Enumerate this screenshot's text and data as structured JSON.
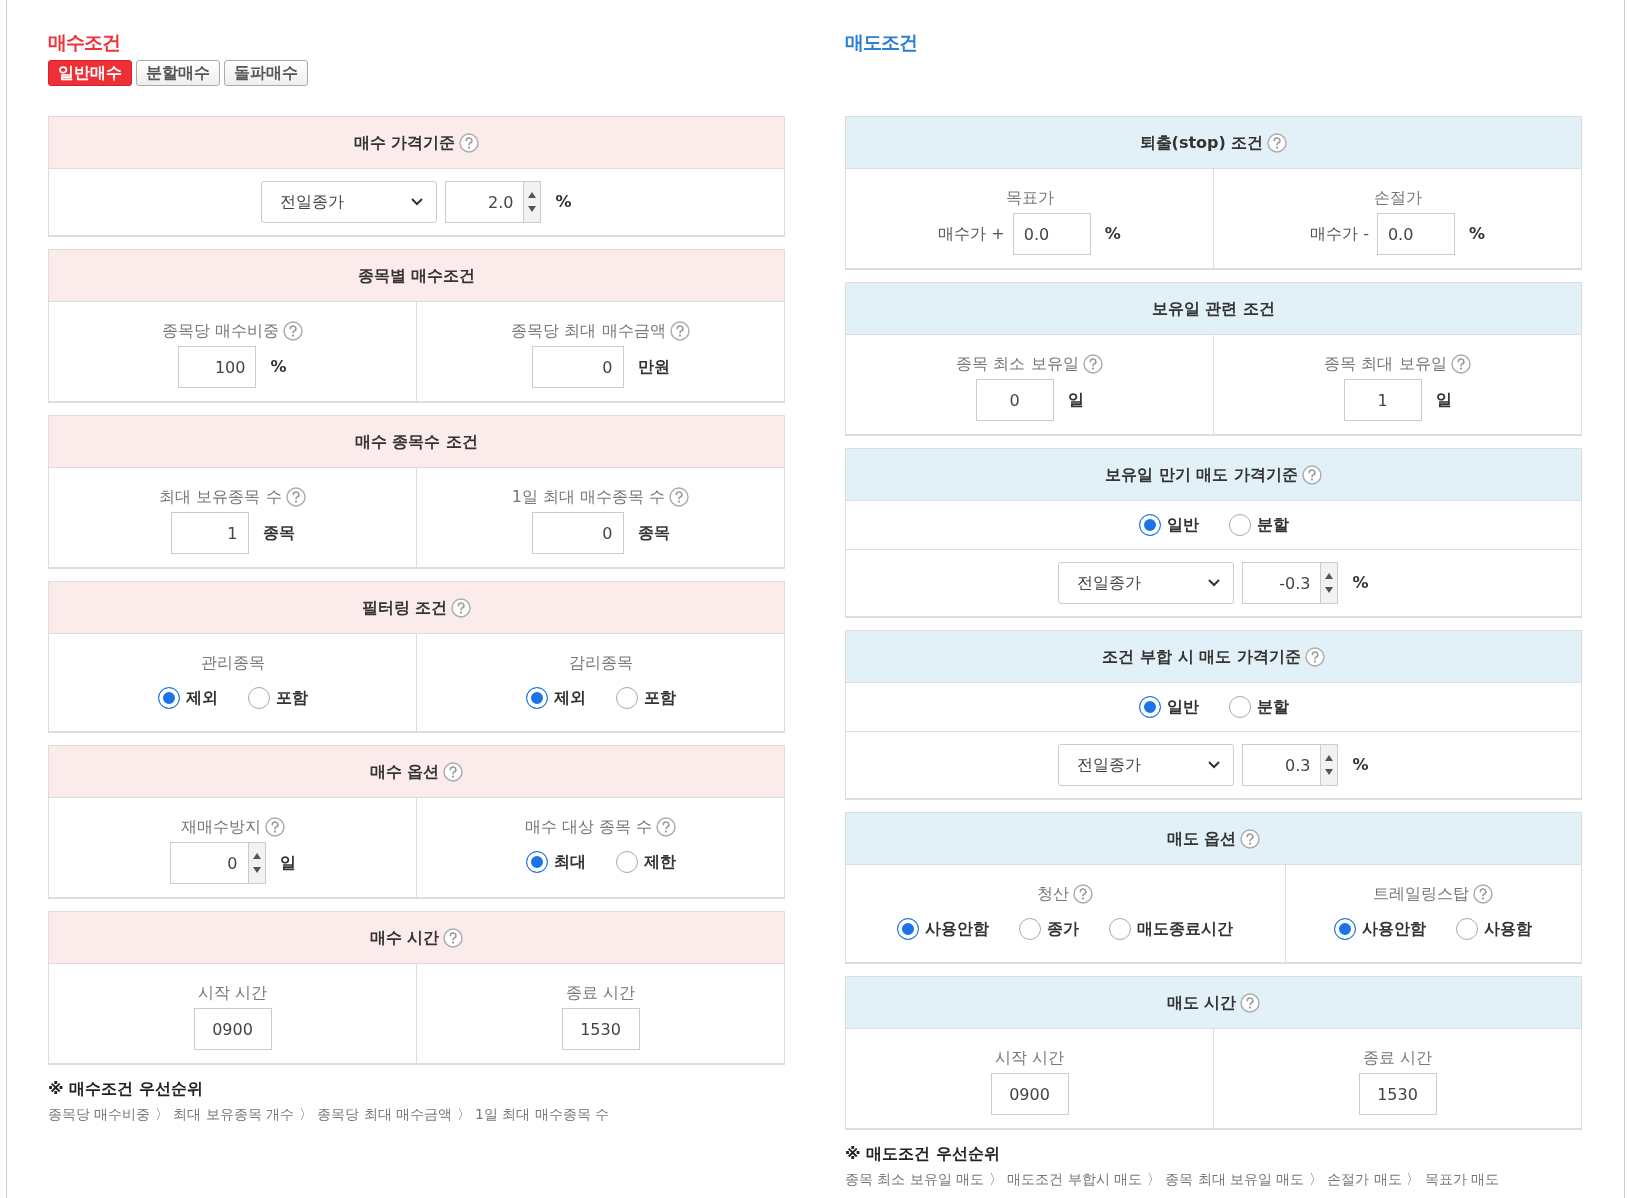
{
  "panels": [
    {
      "kind": "buy",
      "title": "매수조건",
      "tabs": [
        {
          "label": "일반매수",
          "selected": true
        },
        {
          "label": "분할매수",
          "selected": false
        },
        {
          "label": "돌파매수",
          "selected": false
        }
      ],
      "sections": [
        {
          "title": "매수 가격기준",
          "help": true,
          "rows": [
            {
              "cells": [
                {
                  "controls": [
                    {
                      "kind": "select",
                      "value": "전일종가"
                    },
                    {
                      "kind": "number",
                      "value": "2.0",
                      "spinner": true
                    },
                    {
                      "kind": "unit",
                      "text": "%"
                    }
                  ]
                }
              ]
            }
          ]
        },
        {
          "title": "종목별 매수조건",
          "help": false,
          "rows": [
            {
              "cells": [
                {
                  "label": "종목당 매수비중",
                  "help": true,
                  "controls": [
                    {
                      "kind": "number",
                      "value": "100",
                      "spinner": false
                    },
                    {
                      "kind": "unit",
                      "text": "%"
                    }
                  ]
                },
                {
                  "label": "종목당 최대 매수금액",
                  "help": true,
                  "controls": [
                    {
                      "kind": "number",
                      "value": "0",
                      "spinner": false
                    },
                    {
                      "kind": "unit",
                      "text": "만원"
                    }
                  ]
                }
              ]
            }
          ]
        },
        {
          "title": "매수 종목수 조건",
          "help": false,
          "rows": [
            {
              "cells": [
                {
                  "label": "최대 보유종목 수",
                  "help": true,
                  "controls": [
                    {
                      "kind": "number",
                      "value": "1",
                      "spinner": false
                    },
                    {
                      "kind": "unit",
                      "text": "종목"
                    }
                  ]
                },
                {
                  "label": "1일 최대 매수종목 수",
                  "help": true,
                  "controls": [
                    {
                      "kind": "number",
                      "value": "0",
                      "spinner": false
                    },
                    {
                      "kind": "unit",
                      "text": "종목"
                    }
                  ]
                }
              ]
            }
          ]
        },
        {
          "title": "필터링 조건",
          "help": true,
          "rows": [
            {
              "cells": [
                {
                  "label": "관리종목",
                  "help": false,
                  "controls": [
                    {
                      "kind": "radio",
                      "label": "제외",
                      "selected": true
                    },
                    {
                      "kind": "radio",
                      "label": "포함",
                      "selected": false
                    }
                  ]
                },
                {
                  "label": "감리종목",
                  "help": false,
                  "controls": [
                    {
                      "kind": "radio",
                      "label": "제외",
                      "selected": true
                    },
                    {
                      "kind": "radio",
                      "label": "포함",
                      "selected": false
                    }
                  ]
                }
              ]
            }
          ]
        },
        {
          "title": "매수 옵션",
          "help": true,
          "rows": [
            {
              "cells": [
                {
                  "label": "재매수방지",
                  "help": true,
                  "controls": [
                    {
                      "kind": "number",
                      "value": "0",
                      "spinner": true
                    },
                    {
                      "kind": "unit",
                      "text": "일"
                    }
                  ]
                },
                {
                  "label": "매수 대상 종목 수",
                  "help": true,
                  "controls": [
                    {
                      "kind": "radio",
                      "label": "최대",
                      "selected": true
                    },
                    {
                      "kind": "radio",
                      "label": "제한",
                      "selected": false
                    }
                  ]
                }
              ]
            }
          ]
        },
        {
          "title": "매수 시간",
          "help": true,
          "rows": [
            {
              "cells": [
                {
                  "label": "시작 시간",
                  "help": false,
                  "controls": [
                    {
                      "kind": "time",
                      "value": "0900"
                    }
                  ]
                },
                {
                  "label": "종료 시간",
                  "help": false,
                  "controls": [
                    {
                      "kind": "time",
                      "value": "1530"
                    }
                  ]
                }
              ]
            }
          ]
        }
      ],
      "priority": {
        "title": "※ 매수조건 우선순위",
        "text": "종목당 매수비중 〉 최대 보유종목 개수 〉 종목당 최대 매수금액 〉 1일 최대 매수종목 수"
      }
    },
    {
      "kind": "sell",
      "title": "매도조건",
      "sections": [
        {
          "title": "퇴출(stop) 조건",
          "help": true,
          "rows": [
            {
              "cells": [
                {
                  "label": "목표가",
                  "help": false,
                  "controls": [
                    {
                      "kind": "prefix",
                      "text": "매수가 +"
                    },
                    {
                      "kind": "text",
                      "value": "0.0"
                    },
                    {
                      "kind": "unit",
                      "text": "%"
                    }
                  ]
                },
                {
                  "label": "손절가",
                  "help": false,
                  "controls": [
                    {
                      "kind": "prefix",
                      "text": "매수가 -"
                    },
                    {
                      "kind": "text",
                      "value": "0.0"
                    },
                    {
                      "kind": "unit",
                      "text": "%"
                    }
                  ]
                }
              ]
            }
          ]
        },
        {
          "title": "보유일 관련 조건",
          "help": false,
          "rows": [
            {
              "cells": [
                {
                  "label": "종목 최소 보유일",
                  "help": true,
                  "controls": [
                    {
                      "kind": "time",
                      "value": "0"
                    },
                    {
                      "kind": "unit",
                      "text": "일"
                    }
                  ]
                },
                {
                  "label": "종목 최대 보유일",
                  "help": true,
                  "controls": [
                    {
                      "kind": "time",
                      "value": "1"
                    },
                    {
                      "kind": "unit",
                      "text": "일"
                    }
                  ]
                }
              ]
            }
          ]
        },
        {
          "title": "보유일 만기 매도 가격기준",
          "help": true,
          "rows": [
            {
              "cells": [
                {
                  "controls": [
                    {
                      "kind": "radio",
                      "label": "일반",
                      "selected": true
                    },
                    {
                      "kind": "radio",
                      "label": "분할",
                      "selected": false
                    }
                  ]
                }
              ]
            },
            {
              "cells": [
                {
                  "controls": [
                    {
                      "kind": "select",
                      "value": "전일종가"
                    },
                    {
                      "kind": "number",
                      "value": "-0.3",
                      "spinner": true
                    },
                    {
                      "kind": "unit",
                      "text": "%"
                    }
                  ]
                }
              ]
            }
          ]
        },
        {
          "title": "조건 부합 시 매도 가격기준",
          "help": true,
          "rows": [
            {
              "cells": [
                {
                  "controls": [
                    {
                      "kind": "radio",
                      "label": "일반",
                      "selected": true
                    },
                    {
                      "kind": "radio",
                      "label": "분할",
                      "selected": false
                    }
                  ]
                }
              ]
            },
            {
              "cells": [
                {
                  "controls": [
                    {
                      "kind": "select",
                      "value": "전일종가"
                    },
                    {
                      "kind": "number",
                      "value": "0.3",
                      "spinner": true
                    },
                    {
                      "kind": "unit",
                      "text": "%"
                    }
                  ]
                }
              ]
            }
          ]
        },
        {
          "title": "매도 옵션",
          "help": true,
          "rows": [
            {
              "cells": [
                {
                  "label": "청산",
                  "help": true,
                  "controls": [
                    {
                      "kind": "radio",
                      "label": "사용안함",
                      "selected": true
                    },
                    {
                      "kind": "radio",
                      "label": "종가",
                      "selected": false
                    },
                    {
                      "kind": "radio",
                      "label": "매도종료시간",
                      "selected": false
                    }
                  ]
                },
                {
                  "label": "트레일링스탑",
                  "help": true,
                  "controls": [
                    {
                      "kind": "radio",
                      "label": "사용안함",
                      "selected": true
                    },
                    {
                      "kind": "radio",
                      "label": "사용함",
                      "selected": false
                    }
                  ]
                }
              ]
            }
          ]
        },
        {
          "title": "매도 시간",
          "help": true,
          "rows": [
            {
              "cells": [
                {
                  "label": "시작 시간",
                  "help": false,
                  "controls": [
                    {
                      "kind": "time",
                      "value": "0900"
                    }
                  ]
                },
                {
                  "label": "종료 시간",
                  "help": false,
                  "controls": [
                    {
                      "kind": "time",
                      "value": "1530"
                    }
                  ]
                }
              ]
            }
          ]
        }
      ],
      "priority": {
        "title": "※ 매도조건 우선순위",
        "text": "종목 최소 보유일 매도 〉 매도조건 부합시 매도 〉 종목 최대 보유일 매도 〉 손절가 매도 〉 목표가 매도"
      }
    }
  ]
}
